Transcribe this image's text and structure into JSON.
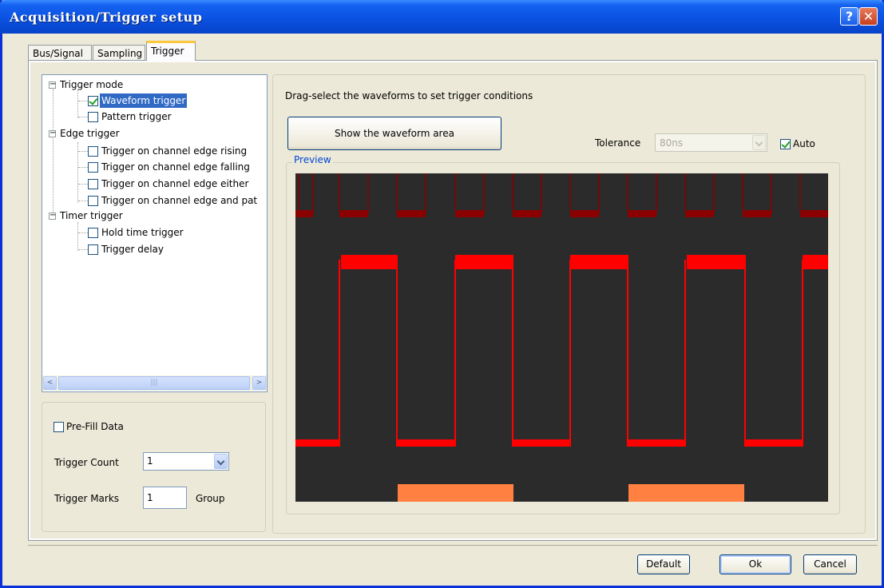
{
  "window": {
    "title": "Acquisition/Trigger setup",
    "help_glyph": "?",
    "close_glyph": "✕"
  },
  "tabs": [
    {
      "label": "Bus/Signal"
    },
    {
      "label": "Sampling"
    },
    {
      "label": "Trigger",
      "active": true
    }
  ],
  "tree": {
    "groups": [
      {
        "label": "Trigger mode",
        "expander": "−",
        "items": [
          {
            "label": "Waveform trigger",
            "checked": true,
            "selected": true
          },
          {
            "label": "Pattern trigger",
            "checked": false
          }
        ]
      },
      {
        "label": "Edge trigger",
        "expander": "−",
        "items": [
          {
            "label": "Trigger on channel edge rising",
            "checked": false
          },
          {
            "label": "Trigger on channel edge falling",
            "checked": false
          },
          {
            "label": "Trigger on channel edge either",
            "checked": false
          },
          {
            "label": "Trigger on channel edge and pat",
            "checked": false
          }
        ]
      },
      {
        "label": "Timer trigger",
        "expander": "−",
        "items": [
          {
            "label": "Hold time trigger",
            "checked": false
          },
          {
            "label": "Trigger delay",
            "checked": false
          }
        ]
      }
    ],
    "scrollbar": {
      "left_glyph": "<",
      "right_glyph": ">",
      "thumb_grip": "|||"
    }
  },
  "options": {
    "prefill_label": "Pre-Fill Data",
    "prefill_checked": false,
    "trigger_count_label": "Trigger Count",
    "trigger_count_value": "1",
    "trigger_marks_label": "Trigger Marks",
    "trigger_marks_value": "1",
    "trigger_marks_unit": "Group"
  },
  "main": {
    "instruction": "Drag-select the waveforms to set trigger conditions",
    "show_waveform_button": "Show the waveform area",
    "tolerance_label": "Tolerance",
    "tolerance_value": "80ns",
    "auto_label": "Auto",
    "auto_checked": true,
    "preview_label": "Preview"
  },
  "waveform": {
    "background": "#2b2b2b",
    "colors": {
      "channel1": "#8b0000",
      "channel2": "#ff0000",
      "channel3": "#ff8040"
    }
  },
  "footer": {
    "default_label": "Default",
    "ok_label": "Ok",
    "cancel_label": "Cancel"
  }
}
